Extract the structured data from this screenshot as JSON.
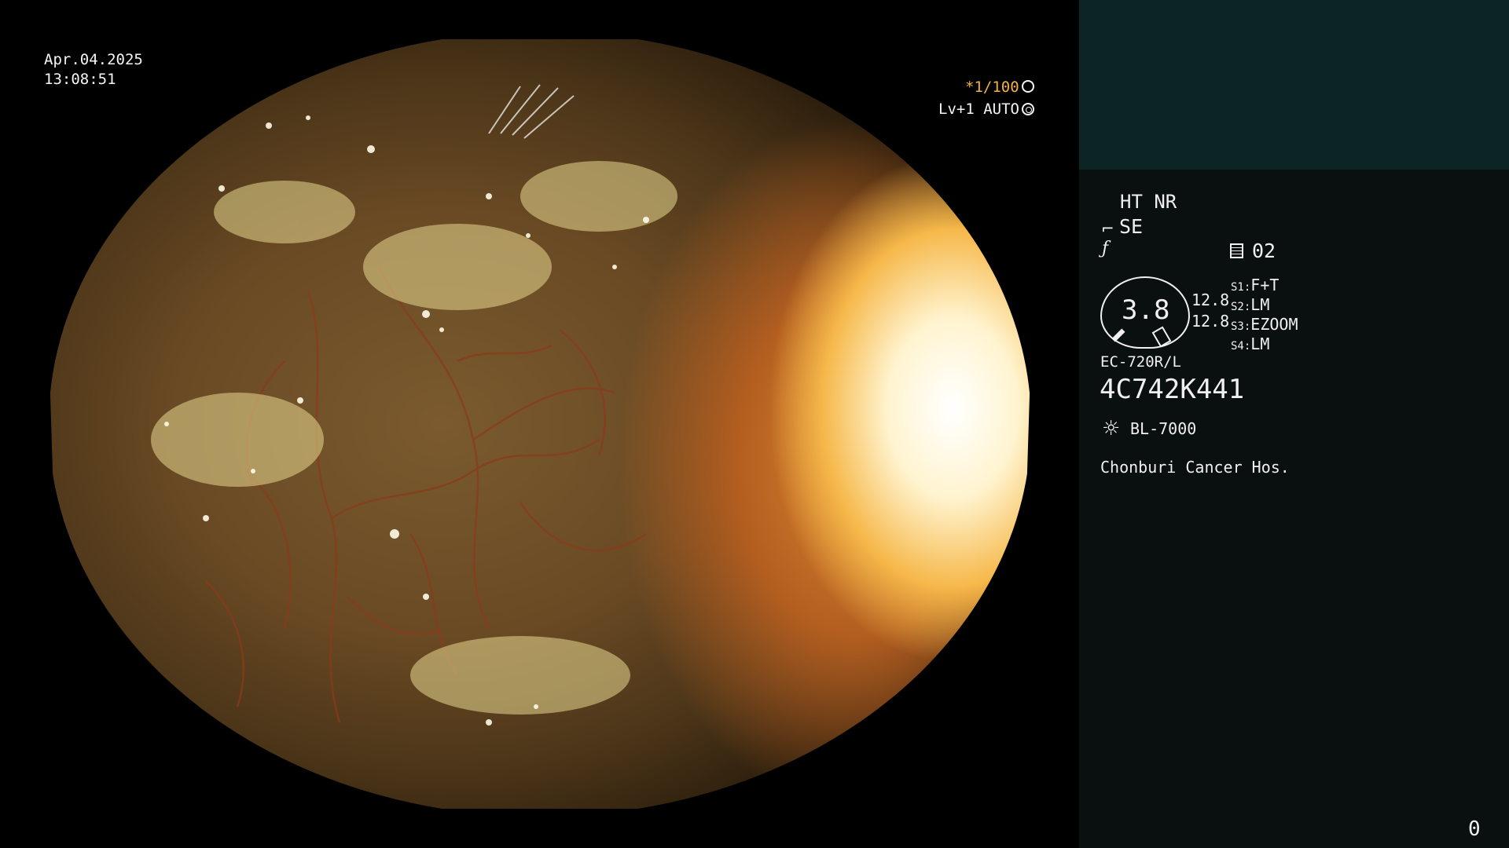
{
  "overlay": {
    "date": "Apr.04.2025",
    "time": "13:08:51",
    "shutter": "*1/100",
    "shutter_icon": "aperture-icon",
    "level": "Lv+1 AUTO",
    "level_icon": "iris-icon"
  },
  "panel": {
    "modes": "HT NR",
    "se_label": "SE",
    "se_icon": "scope-hook-icon",
    "f_icon": "f-slash-icon",
    "preset_number": "02",
    "preset_icon": "memory-icon",
    "gauge_value": "3.8",
    "gauge_values": [
      "12.8",
      "12.8"
    ],
    "s_buttons": [
      {
        "key": "S1",
        "value": "F+T"
      },
      {
        "key": "S2",
        "value": "LM"
      },
      {
        "key": "S3",
        "value": "EZOOM"
      },
      {
        "key": "S4",
        "value": "LM"
      }
    ],
    "scope_model": "EC-720R/L",
    "scope_serial": "4C742K441",
    "light_source": "BL-7000",
    "light_icon": "sun-icon",
    "hospital": "Chonburi Cancer Hos.",
    "counter": "0"
  },
  "colors": {
    "side_top": "#0d2424",
    "side_bottom": "#0a1010",
    "se_orange": "#f5b040"
  }
}
